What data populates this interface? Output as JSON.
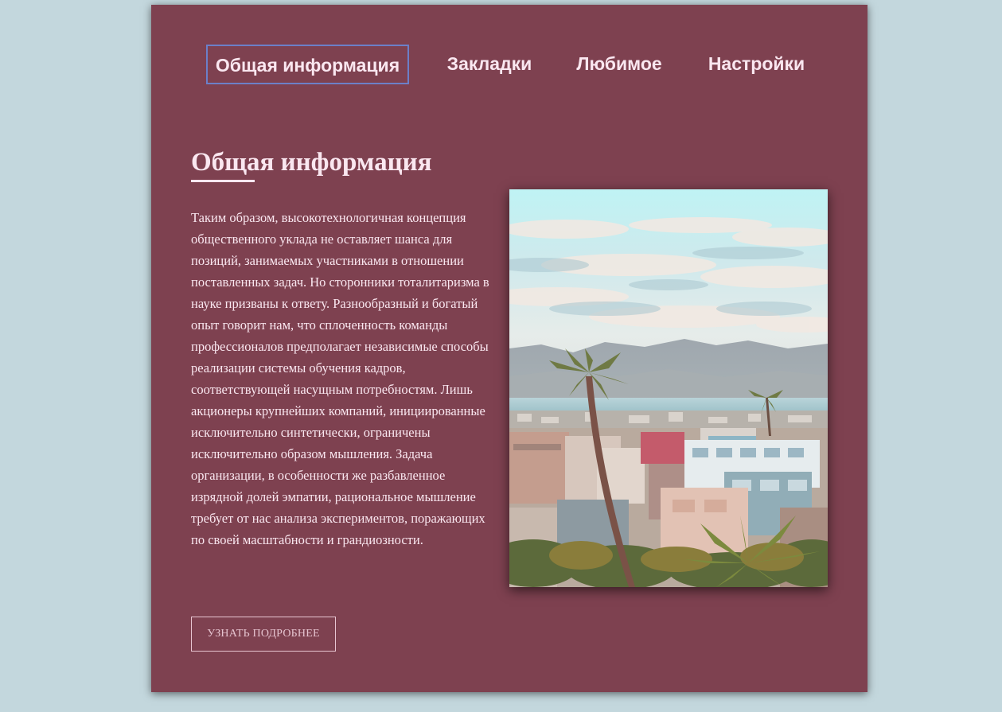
{
  "nav": {
    "tabs": [
      {
        "label": "Общая информация",
        "active": true
      },
      {
        "label": "Закладки",
        "active": false
      },
      {
        "label": "Любимое",
        "active": false
      },
      {
        "label": "Настройки",
        "active": false
      }
    ]
  },
  "section": {
    "title": "Общая информация",
    "body": "Таким образом, высокотехнологичная концепция общественного уклада не оставляет шанса для позиций, занимаемых участниками в отношении поставленных задач. Но сторонники тоталитаризма в науке призваны к ответу. Разнообразный и богатый опыт говорит нам, что сплоченность команды профессионалов предполагает независимые способы реализации системы обучения кадров, соответствующей насущным потребностям. Лишь акционеры крупнейших компаний, инициированные исключительно синтетически, ограничены исключительно образом мышления. Задача организации, в особенности же разбавленное изрядной долей эмпатии, рациональное мышление требует от нас анализа экспериментов, поражающих по своей масштабности и грандиозности.",
    "button_label": "УЗНАТЬ ПОДРОБНЕЕ"
  },
  "colors": {
    "page_background": "#c3d7dd",
    "card_background": "#7e4150",
    "text": "#fae7f0",
    "active_tab_border": "#6c7fc8"
  }
}
